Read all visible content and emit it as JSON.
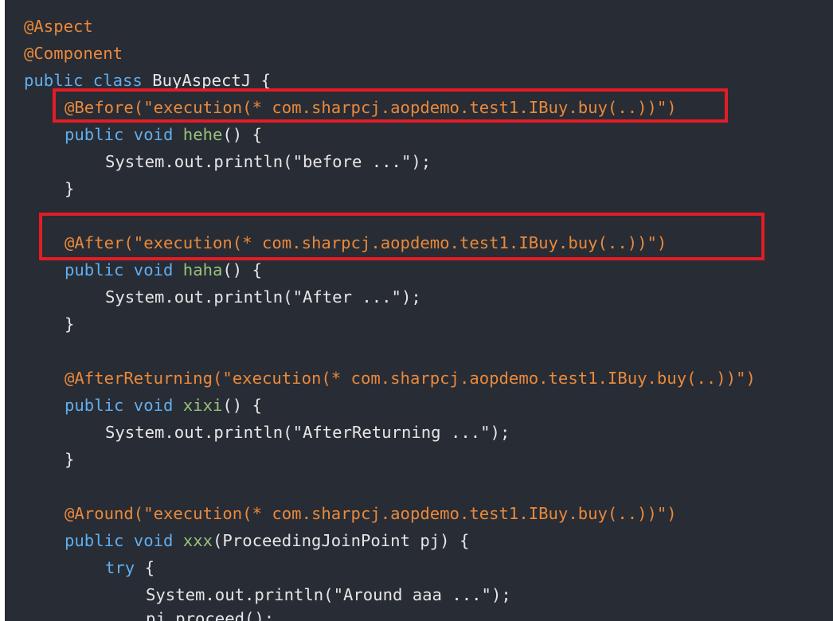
{
  "colors": {
    "background": "#282c34",
    "annotation": "#e9893c",
    "keyword": "#61aeee",
    "function": "#98c379",
    "plain": "#e6e6e6",
    "highlight": "#e31c25"
  },
  "code": {
    "l1": {
      "ann": "@Aspect"
    },
    "l2": {
      "ann": "@Component"
    },
    "l3": {
      "kw": "public class",
      "rest": " BuyAspectJ {"
    },
    "l4": {
      "ann": "@Before(\"execution(* com.sharpcj.aopdemo.test1.IBuy.buy(..))\")"
    },
    "l5": {
      "kw": "public void",
      "fn": "hehe",
      "rest": "() {"
    },
    "l6": {
      "text": "System.out.println(\"before ...\");"
    },
    "l7": {
      "text": "}"
    },
    "l9": {
      "ann": "@After(\"execution(* com.sharpcj.aopdemo.test1.IBuy.buy(..))\")"
    },
    "l10": {
      "kw": "public void",
      "fn": "haha",
      "rest": "() {"
    },
    "l11": {
      "text": "System.out.println(\"After ...\");"
    },
    "l12": {
      "text": "}"
    },
    "l14": {
      "ann": "@AfterReturning(\"execution(* com.sharpcj.aopdemo.test1.IBuy.buy(..))\")"
    },
    "l15": {
      "kw": "public void",
      "fn": "xixi",
      "rest": "() {"
    },
    "l16": {
      "text": "System.out.println(\"AfterReturning ...\");"
    },
    "l17": {
      "text": "}"
    },
    "l19": {
      "ann": "@Around(\"execution(* com.sharpcj.aopdemo.test1.IBuy.buy(..))\")"
    },
    "l20": {
      "kw": "public void",
      "fn": "xxx",
      "rest": "(ProceedingJoinPoint pj) {"
    },
    "l21": {
      "kw": "try",
      "rest": " {"
    },
    "l22": {
      "text": "System.out.println(\"Around aaa ...\");"
    },
    "l23": {
      "text": "pj.proceed();"
    }
  }
}
